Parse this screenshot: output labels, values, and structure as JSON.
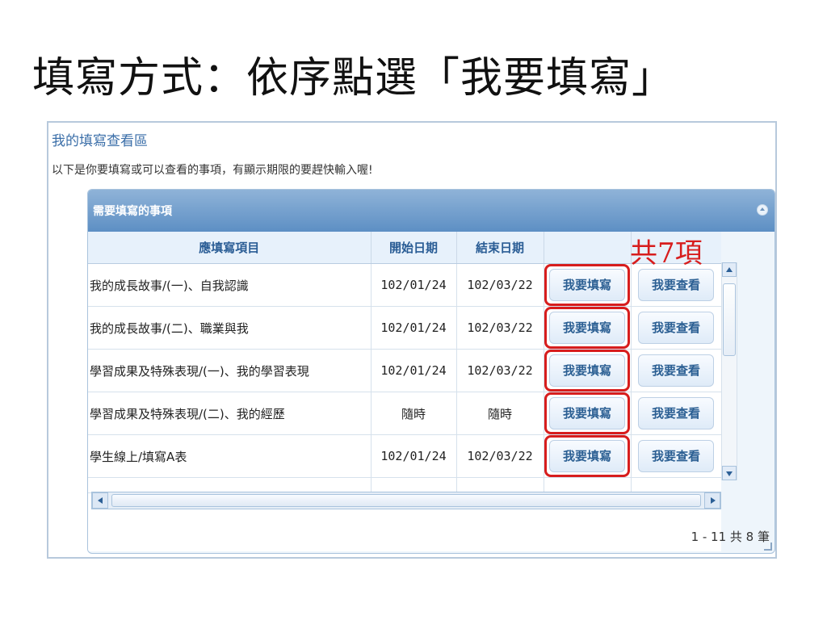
{
  "slide": {
    "title": "填寫方式：依序點選「我要填寫」"
  },
  "panel": {
    "heading": "我的填寫查看區",
    "description": "以下是你要填寫或可以查看的事項，有顯示期限的要趕快輸入喔!"
  },
  "grid": {
    "title": "需要填寫的事項",
    "columns": [
      "應填寫項目",
      "開始日期",
      "結束日期"
    ],
    "write_button": "我要填寫",
    "view_button": "我要查看",
    "rows": [
      {
        "item": "我的成長故事/(一)、自我認識",
        "start": "102/01/24",
        "end": "102/03/22"
      },
      {
        "item": "我的成長故事/(二)、職業與我",
        "start": "102/01/24",
        "end": "102/03/22"
      },
      {
        "item": "學習成果及特殊表現/(一)、我的學習表現",
        "start": "102/01/24",
        "end": "102/03/22"
      },
      {
        "item": "學習成果及特殊表現/(二)、我的經歷",
        "start": "隨時",
        "end": "隨時"
      },
      {
        "item": "學生線上/填寫A表",
        "start": "102/01/24",
        "end": "102/03/22"
      }
    ],
    "pager": "1 - 11  共 8 筆"
  },
  "annotation": {
    "count_text": "共7項",
    "color": "#d71d1d"
  }
}
